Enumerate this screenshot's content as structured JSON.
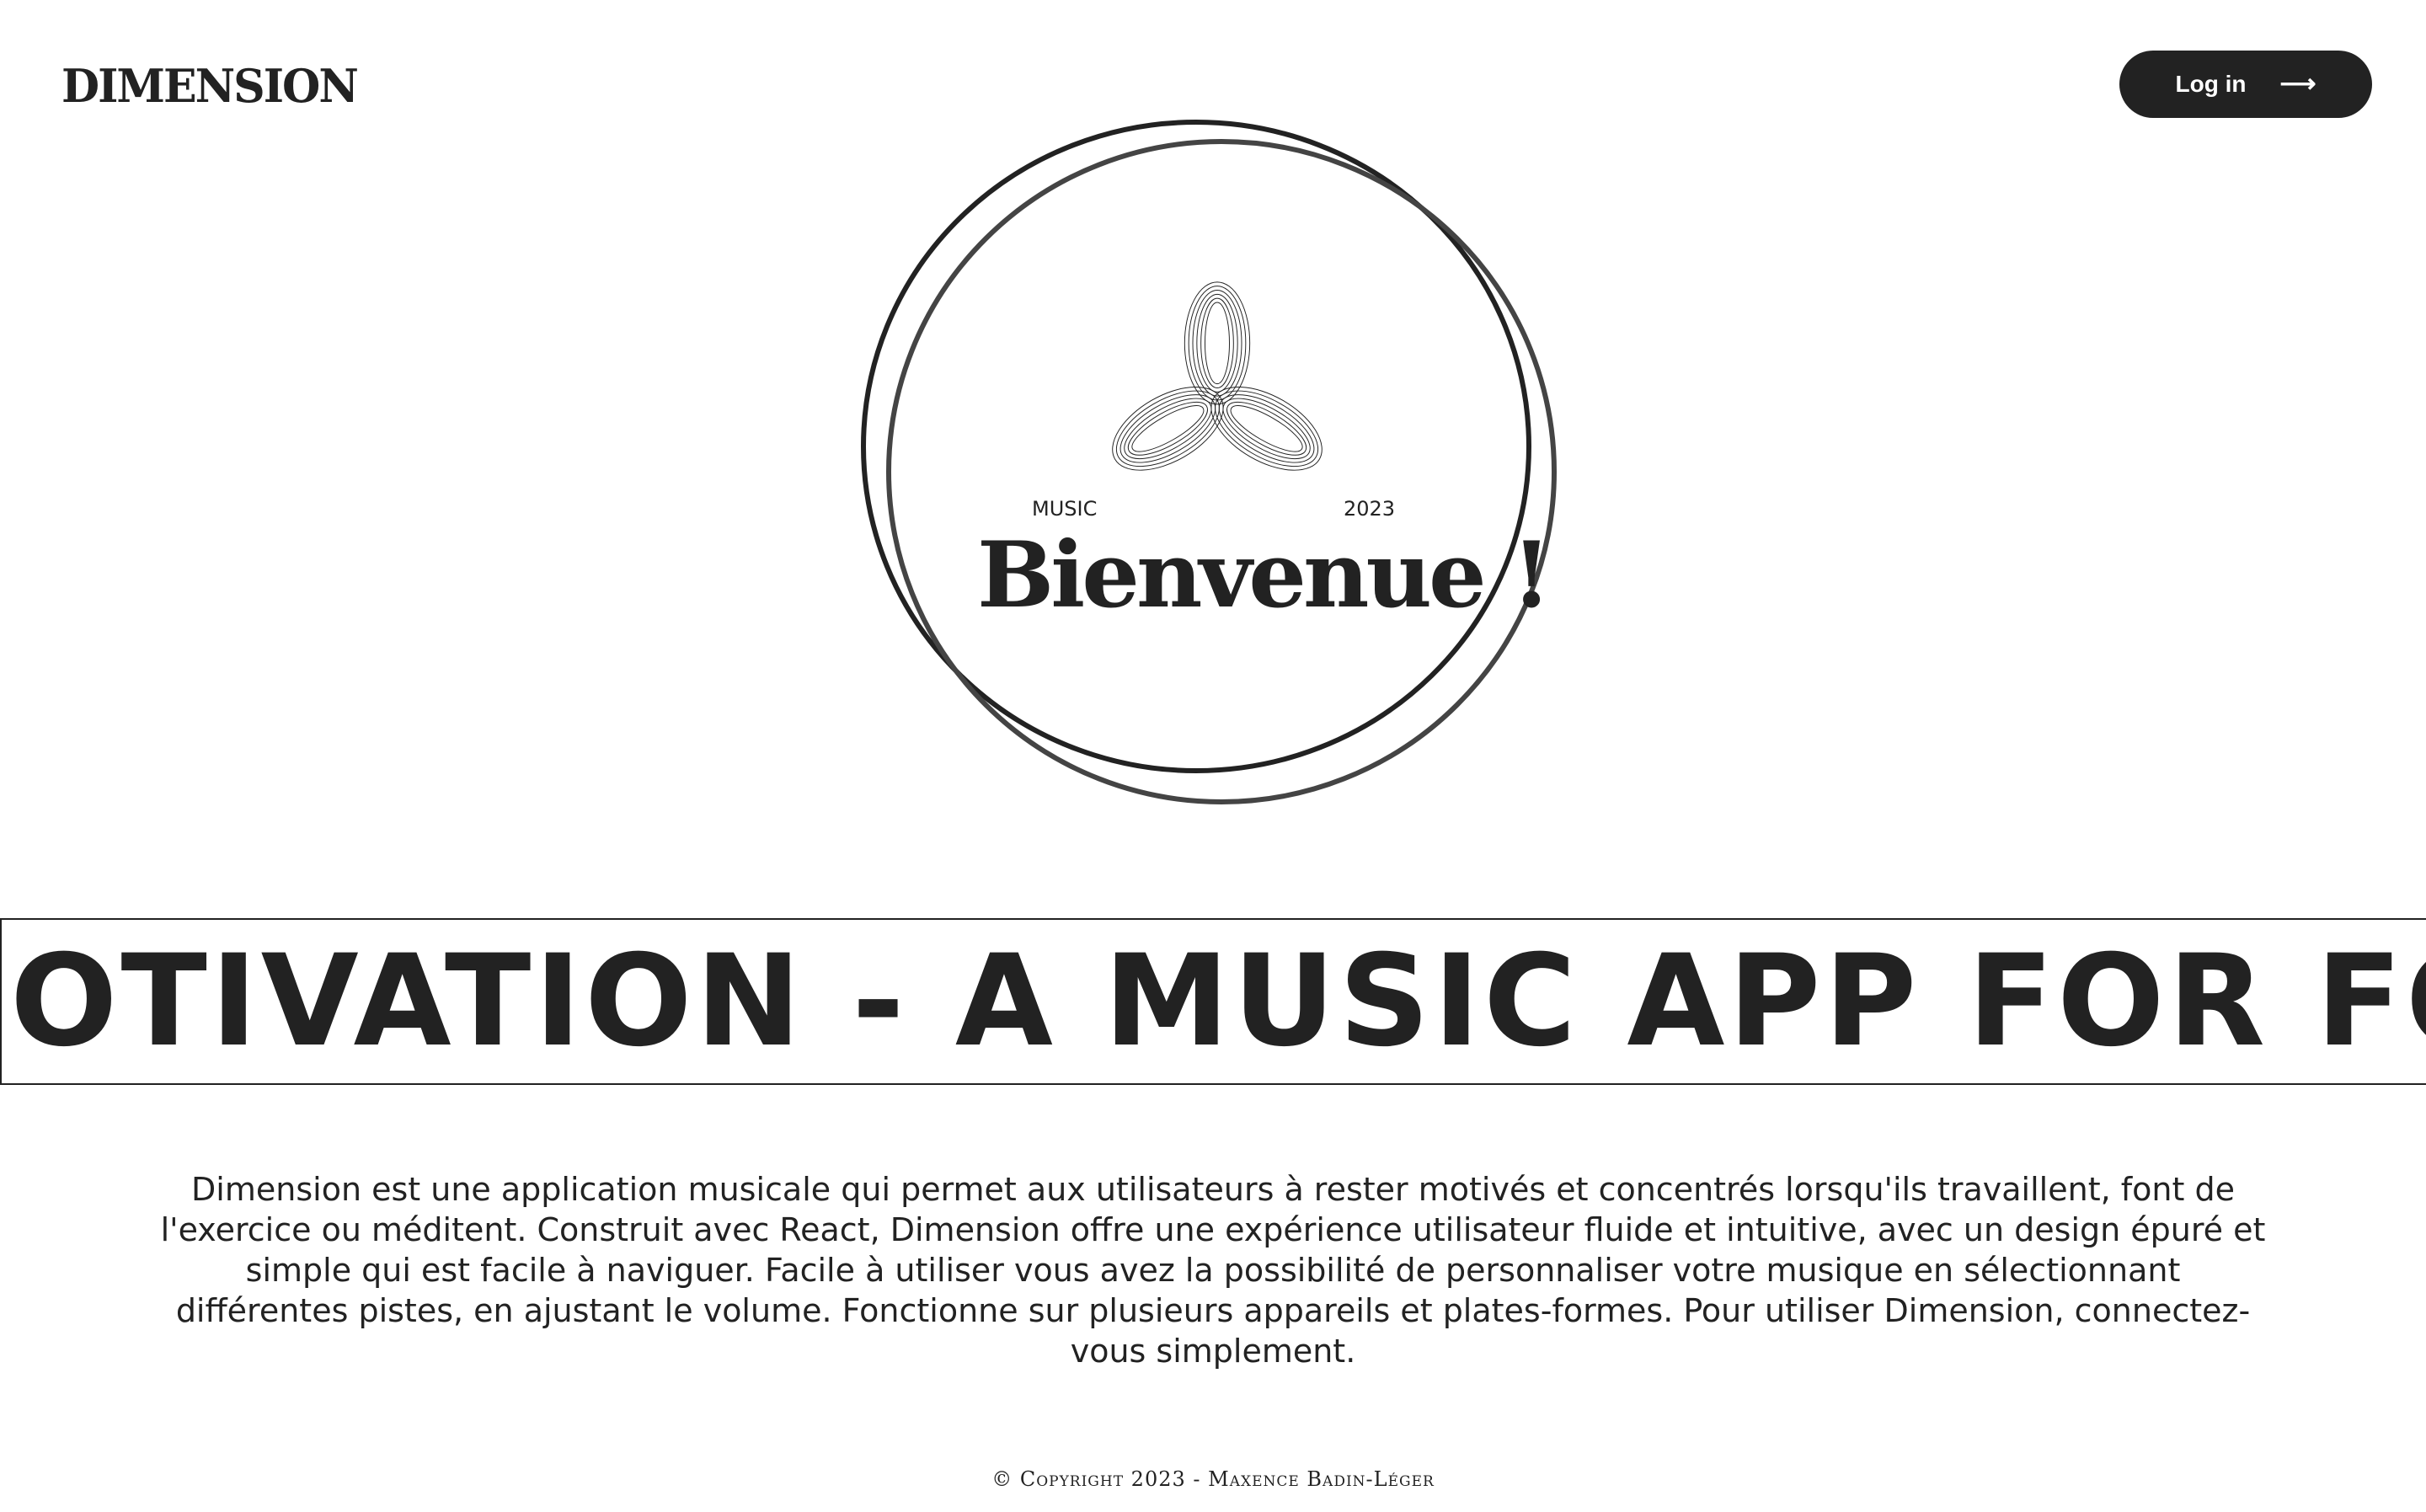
{
  "header": {
    "brand": "DIMENSION",
    "login_label": "Log in",
    "login_icon": "arrow-right-icon"
  },
  "hero": {
    "tag_left": "MUSIC",
    "tag_right": "2023",
    "title": "Bienvenue !"
  },
  "marquee": {
    "text": "OTIVATION - A MUSIC APP FOR FOC"
  },
  "description": {
    "text": "Dimension est une application musicale qui permet aux utilisateurs à rester motivés et concentrés lorsqu'ils travaillent, font de l'exercice ou méditent. Construit avec React, Dimension offre une expérience utilisateur fluide et intuitive, avec un design épuré et simple qui est facile à naviguer. Facile à utiliser vous avez la possibilité de personnaliser votre musique en sélectionnant différentes pistes, en ajustant le volume. Fonctionne sur plusieurs appareils et plates-formes. Pour utiliser Dimension, connectez-vous simplement."
  },
  "footer": {
    "copyright": "© Copyright 2023 - Maxence Badin-Léger"
  },
  "colors": {
    "ink": "#222222",
    "background": "#ffffff",
    "button_bg": "#222222",
    "button_text": "#ffffff"
  }
}
